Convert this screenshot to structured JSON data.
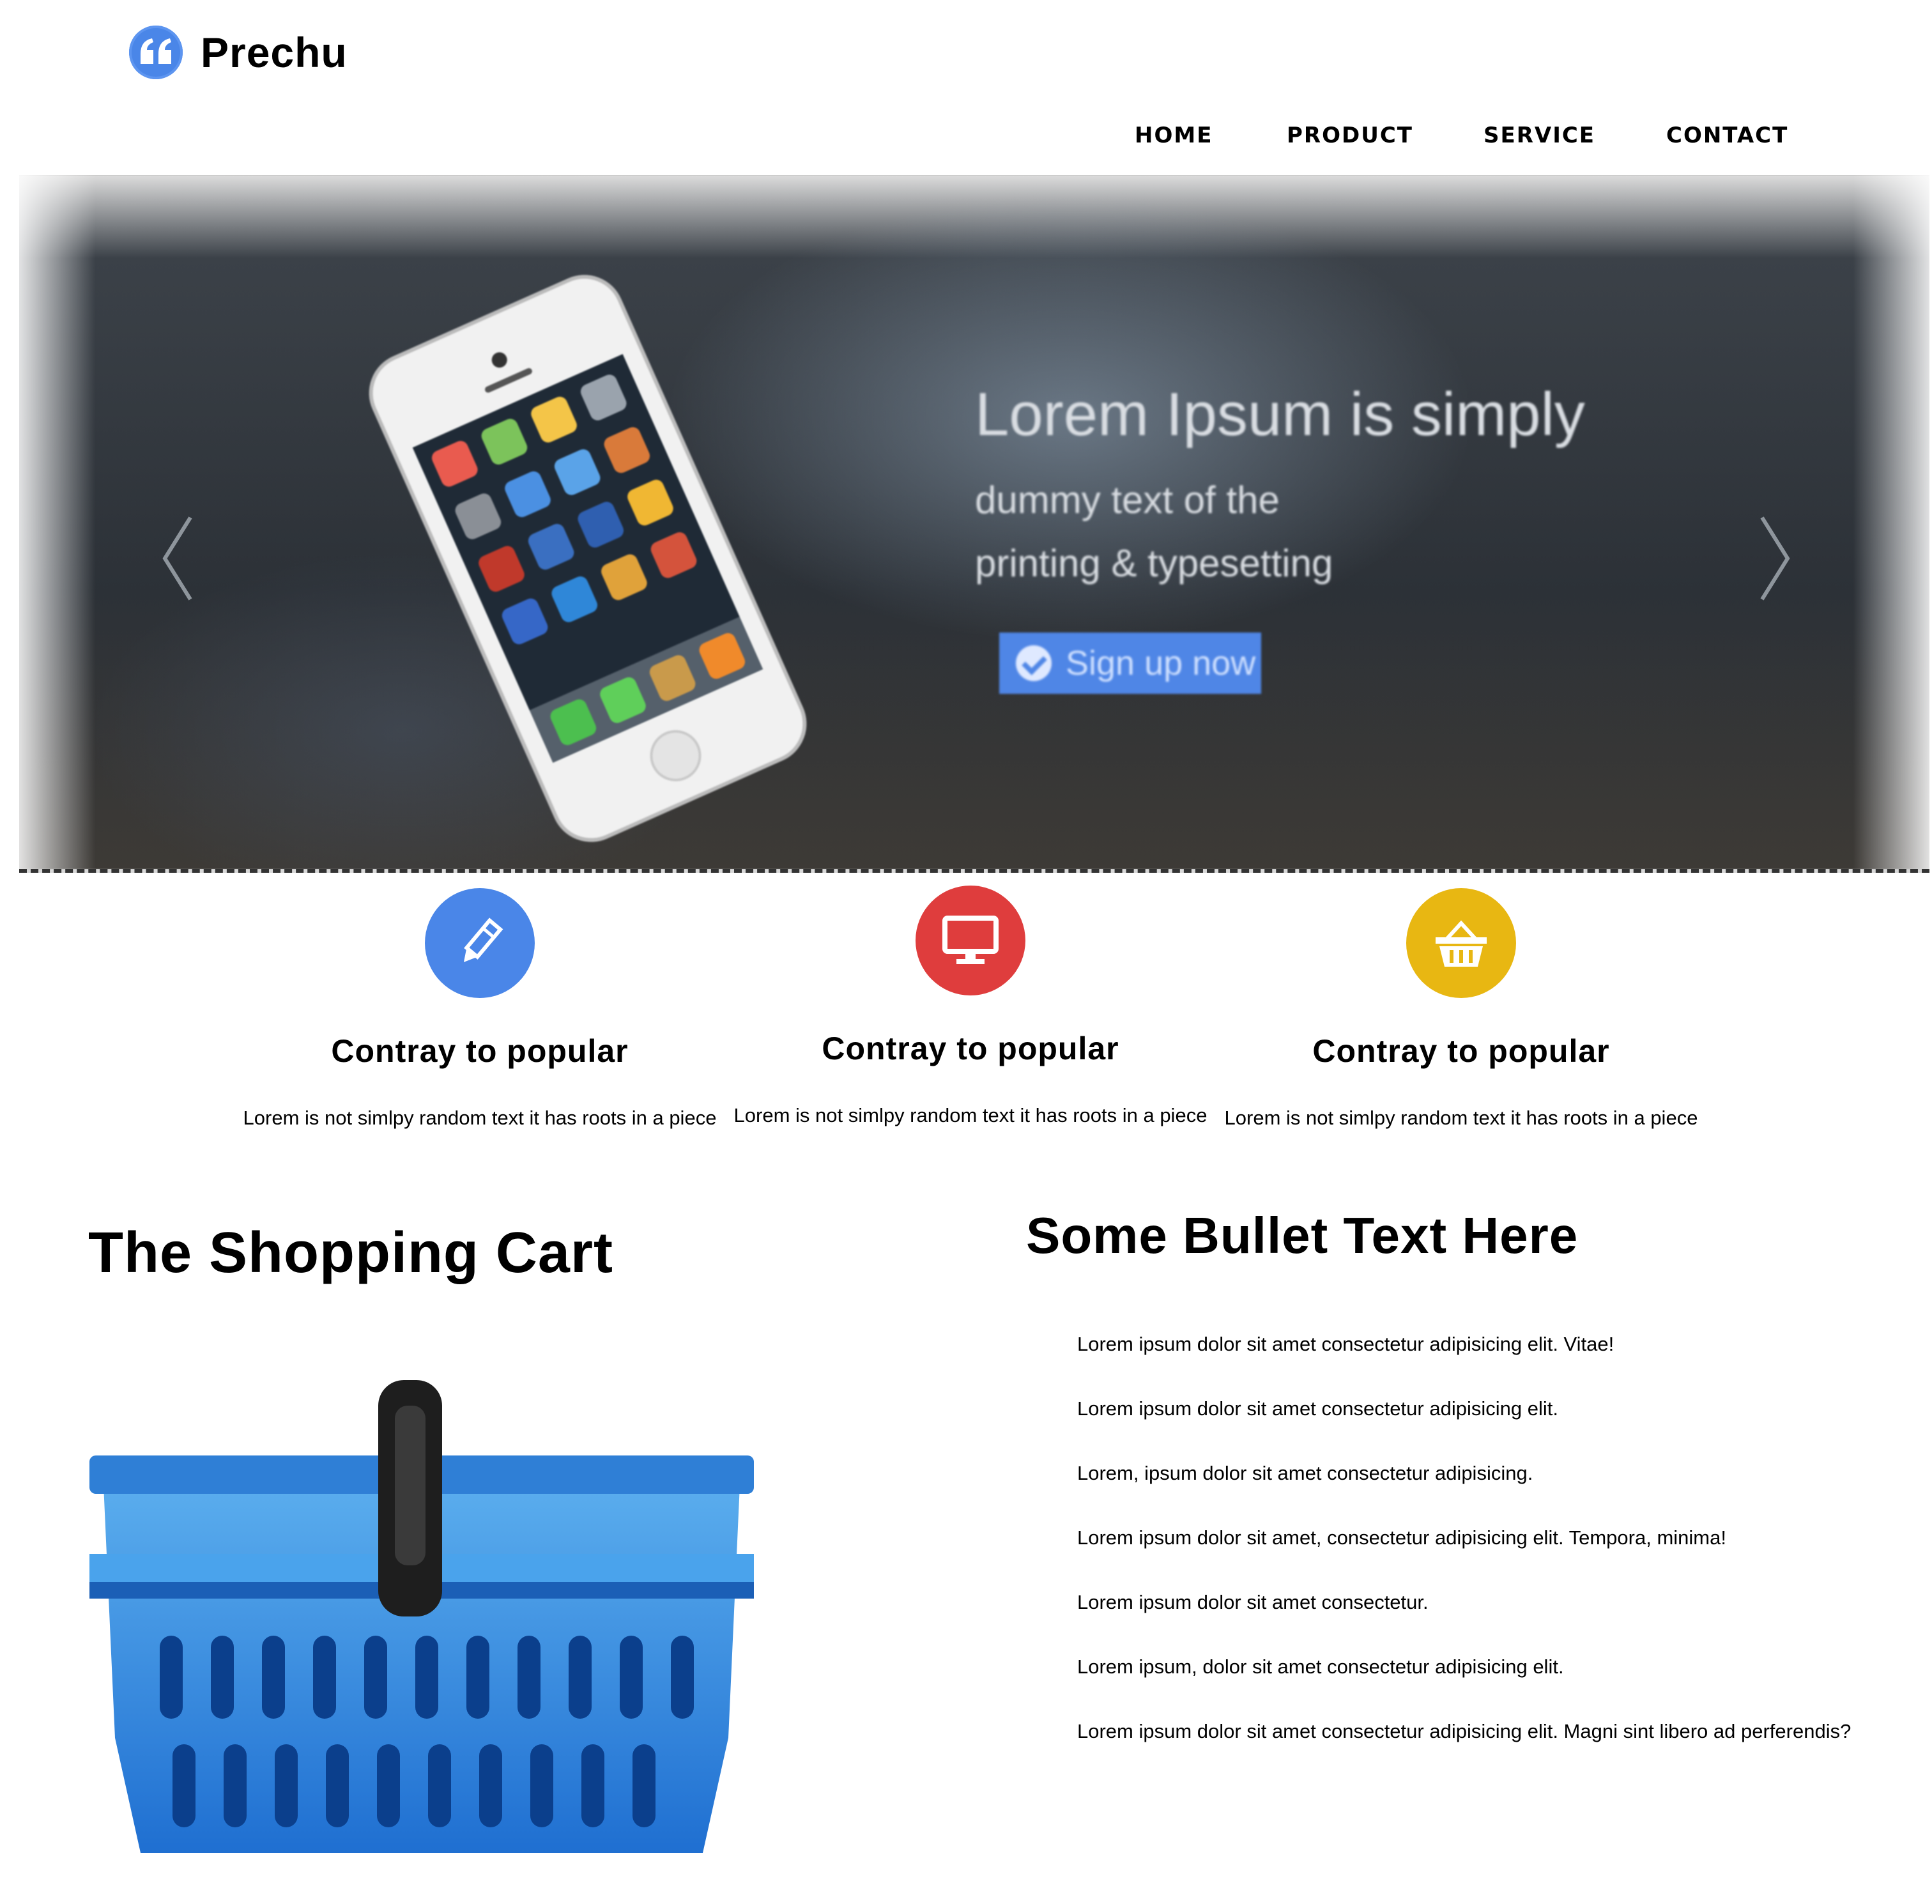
{
  "brand": {
    "name": "Prechu",
    "logo_icon": "quote-icon",
    "logo_color": "#4a86e8"
  },
  "nav": {
    "items": [
      {
        "label": "HOME"
      },
      {
        "label": "PRODUCT"
      },
      {
        "label": "SERVICE"
      },
      {
        "label": "CONTACT"
      }
    ]
  },
  "hero": {
    "headline": "Lorem Ipsum is simply",
    "subline_1": "dummy text of the",
    "subline_2": "printing & typesetting",
    "cta_label": "Sign up now",
    "cta_color": "#4f86e6",
    "prev_icon": "chevron-left-icon",
    "next_icon": "chevron-right-icon",
    "image": "smartphone-image"
  },
  "features": [
    {
      "icon": "pencil-icon",
      "color": "#4a86e8",
      "title": "Contray to popular",
      "text": "Lorem is not simlpy random text it has roots in a piece"
    },
    {
      "icon": "monitor-icon",
      "color": "#df3d3d",
      "title": "Contray to popular",
      "text": "Lorem is not simlpy random text it has roots in a piece"
    },
    {
      "icon": "basket-icon",
      "color": "#e8b712",
      "title": "Contray to popular",
      "text": "Lorem is not simlpy random text it has roots in a piece"
    }
  ],
  "cart": {
    "title": "The Shopping Cart",
    "image": "shopping-basket-image",
    "color": "#2e86de"
  },
  "bullets": {
    "title": "Some Bullet Text Here",
    "items": [
      "Lorem ipsum dolor sit amet consectetur adipisicing elit. Vitae!",
      "Lorem ipsum dolor sit amet consectetur adipisicing elit.",
      "Lorem, ipsum dolor sit amet consectetur adipisicing.",
      "Lorem ipsum dolor sit amet, consectetur adipisicing elit. Tempora, minima!",
      "Lorem ipsum dolor sit amet consectetur.",
      "Lorem ipsum, dolor sit amet consectetur adipisicing elit.",
      "Lorem ipsum dolor sit amet consectetur adipisicing elit. Magni sint libero ad perferendis?"
    ]
  }
}
